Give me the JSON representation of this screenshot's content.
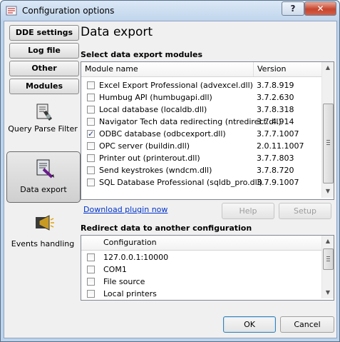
{
  "window": {
    "title": "Configuration options"
  },
  "titlebar_buttons": {
    "help": "?",
    "close": "✕"
  },
  "sidebar": {
    "tabs": [
      "DDE settings",
      "Log file",
      "Other",
      "Modules"
    ],
    "modules": [
      {
        "label": "Query Parse Filter",
        "icon": "query-parse-filter-icon"
      },
      {
        "label": "Data export",
        "icon": "data-export-icon",
        "selected": true
      },
      {
        "label": "Events handling",
        "icon": "events-handling-icon"
      }
    ]
  },
  "main": {
    "title": "Data export",
    "modules_section": "Select data export modules",
    "columns": {
      "module": "Module name",
      "version": "Version"
    },
    "rows": [
      {
        "name": "Excel Export Professional (advexcel.dll)",
        "version": "3.7.8.919",
        "checked": false
      },
      {
        "name": "Humbug API (humbugapi.dll)",
        "version": "3.7.2.630",
        "checked": false
      },
      {
        "name": "Local database (localdb.dll)",
        "version": "3.7.8.318",
        "checked": false
      },
      {
        "name": "Navigator Tech data redirecting (ntredirect.dll)",
        "version": "3.7.4.914",
        "checked": false
      },
      {
        "name": "ODBC database (odbcexport.dll)",
        "version": "3.7.7.1007",
        "checked": true
      },
      {
        "name": "OPC server (buildin.dll)",
        "version": "2.0.11.1007",
        "checked": false
      },
      {
        "name": "Printer out (printerout.dll)",
        "version": "3.7.7.803",
        "checked": false
      },
      {
        "name": "Send keystrokes (wndcm.dll)",
        "version": "3.7.8.720",
        "checked": false
      },
      {
        "name": "SQL Database Professional (sqldb_pro.dll)",
        "version": "3.7.9.1007",
        "checked": false
      }
    ],
    "download_link": "Download plugin now",
    "help_button": "Help",
    "setup_button": "Setup",
    "redirect_section": "Redirect data to another configuration",
    "redirect_column": "Configuration",
    "redirect_rows": [
      {
        "name": "127.0.0.1:10000",
        "checked": false
      },
      {
        "name": "COM1",
        "checked": false
      },
      {
        "name": "File source",
        "checked": false
      },
      {
        "name": "Local printers",
        "checked": false
      }
    ]
  },
  "footer": {
    "ok": "OK",
    "cancel": "Cancel"
  },
  "colors": {
    "selection_accent": "#3c7fb1",
    "link": "#0033cc",
    "close": "#c7452d"
  }
}
